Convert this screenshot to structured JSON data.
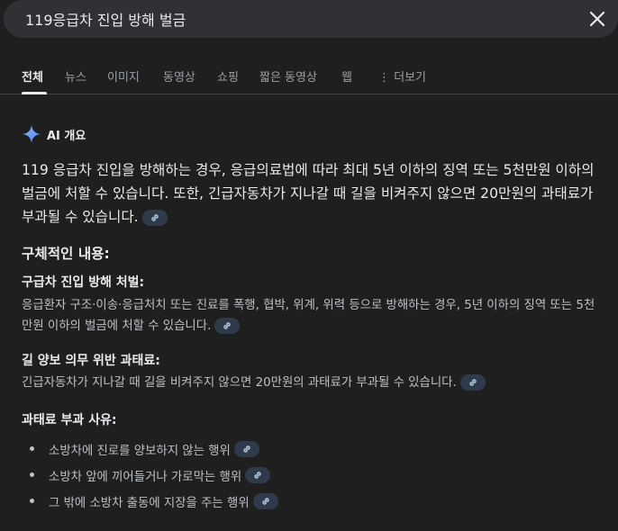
{
  "search": {
    "query": "119응급차 진입 방해 벌금"
  },
  "tabs": [
    {
      "label": "전체"
    },
    {
      "label": "뉴스"
    },
    {
      "label": "이미지"
    },
    {
      "label": "동영상"
    },
    {
      "label": "쇼핑"
    },
    {
      "label": "짧은 동영상"
    },
    {
      "label": "웹"
    },
    {
      "label": "⋮ 더보기"
    }
  ],
  "ai_overview": {
    "title": "AI 개요",
    "summary": "119 응급차 진입을 방해하는 경우, 응급의료법에 따라 최대 5년 이하의 징역 또는 5천만원 이하의 벌금에 처할 수 있습니다. 또한, 긴급자동차가 지나갈 때 길을 비켜주지 않으면 20만원의 과태료가 부과될 수 있습니다.",
    "details_title": "구체적인 내용:",
    "sections": [
      {
        "title": "구급차 진입 방해 처벌:",
        "text": "응급환자 구조·이송·응급처치 또는 진료를 폭행, 협박, 위계, 위력 등으로 방해하는 경우, 5년 이하의 징역 또는 5천만원 이하의 벌금에 처할 수 있습니다."
      },
      {
        "title": "길 양보 의무 위반 과태료:",
        "text": "긴급자동차가 지나갈 때 길을 비켜주지 않으면 20만원의 과태료가 부과될 수 있습니다."
      },
      {
        "title": "과태료 부과 사유:"
      }
    ],
    "bullets": [
      "소방차에 진로를 양보하지 않는 행위",
      "소방차 앞에 끼어들거나 가로막는 행위",
      "그 밖에 소방차 출동에 지장을 주는 행위"
    ]
  },
  "colors": {
    "background": "#1f1f1f",
    "search_bar": "#303134",
    "link_chip": "#2f3a4a",
    "sparkle": "#8ab4f8"
  },
  "icons": [
    "close-icon",
    "sparkle-icon",
    "link-icon"
  ]
}
